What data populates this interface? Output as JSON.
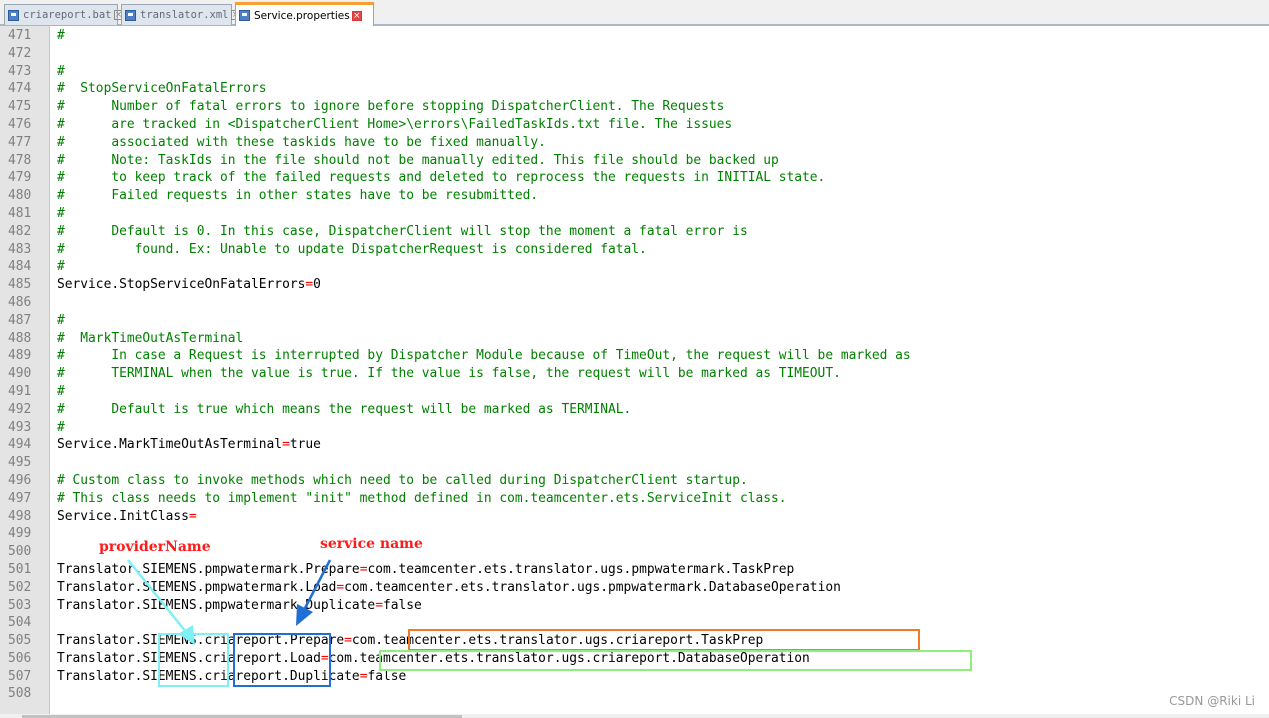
{
  "tabs": [
    {
      "label": "criareport.bat",
      "active": false
    },
    {
      "label": "translator.xml",
      "active": false
    },
    {
      "label": "Service.properties",
      "active": true
    }
  ],
  "editor": {
    "lines": [
      {
        "num": "471",
        "text": "#"
      },
      {
        "num": "472",
        "text": ""
      },
      {
        "num": "473",
        "text": "#"
      },
      {
        "num": "474",
        "text": "#  StopServiceOnFatalErrors"
      },
      {
        "num": "475",
        "text": "#      Number of fatal errors to ignore before stopping DispatcherClient. The Requests"
      },
      {
        "num": "476",
        "text": "#      are tracked in <DispatcherClient Home>\\errors\\FailedTaskIds.txt file. The issues"
      },
      {
        "num": "477",
        "text": "#      associated with these taskids have to be fixed manually."
      },
      {
        "num": "478",
        "text": "#      Note: TaskIds in the file should not be manually edited. This file should be backed up"
      },
      {
        "num": "479",
        "text": "#      to keep track of the failed requests and deleted to reprocess the requests in INITIAL state."
      },
      {
        "num": "480",
        "text": "#      Failed requests in other states have to be resubmitted."
      },
      {
        "num": "481",
        "text": "#"
      },
      {
        "num": "482",
        "text": "#      Default is 0. In this case, DispatcherClient will stop the moment a fatal error is"
      },
      {
        "num": "483",
        "text": "#         found. Ex: Unable to update DispatcherRequest is considered fatal."
      },
      {
        "num": "484",
        "text": "#"
      },
      {
        "num": "485",
        "key": "Service.StopServiceOnFatalErrors",
        "value": "0"
      },
      {
        "num": "486",
        "text": ""
      },
      {
        "num": "487",
        "text": "#"
      },
      {
        "num": "488",
        "text": "#  MarkTimeOutAsTerminal"
      },
      {
        "num": "489",
        "text": "#      In case a Request is interrupted by Dispatcher Module because of TimeOut, the request will be marked as"
      },
      {
        "num": "490",
        "text": "#      TERMINAL when the value is true. If the value is false, the request will be marked as TIMEOUT."
      },
      {
        "num": "491",
        "text": "#"
      },
      {
        "num": "492",
        "text": "#      Default is true which means the request will be marked as TERMINAL."
      },
      {
        "num": "493",
        "text": "#"
      },
      {
        "num": "494",
        "key": "Service.MarkTimeOutAsTerminal",
        "value": "true"
      },
      {
        "num": "495",
        "text": ""
      },
      {
        "num": "496",
        "text": "# Custom class to invoke methods which need to be called during DispatcherClient startup."
      },
      {
        "num": "497",
        "text": "# This class needs to implement \"init\" method defined in com.teamcenter.ets.ServiceInit class."
      },
      {
        "num": "498",
        "key": "Service.InitClass",
        "value": ""
      },
      {
        "num": "499",
        "text": ""
      },
      {
        "num": "500",
        "text": ""
      },
      {
        "num": "501",
        "key": "Translator.SIEMENS.pmpwatermark.Prepare",
        "value": "com.teamcenter.ets.translator.ugs.pmpwatermark.TaskPrep"
      },
      {
        "num": "502",
        "key": "Translator.SIEMENS.pmpwatermark.Load",
        "value": "com.teamcenter.ets.translator.ugs.pmpwatermark.DatabaseOperation"
      },
      {
        "num": "503",
        "key": "Translator.SIEMENS.pmpwatermark.Duplicate",
        "value": "false"
      },
      {
        "num": "504",
        "text": ""
      },
      {
        "num": "505",
        "key": "Translator.SIEMENS.criareport.Prepare",
        "value": "com.teamcenter.ets.translator.ugs.criareport.TaskPrep"
      },
      {
        "num": "506",
        "key": "Translator.SIEMENS.criareport.Load",
        "value": "com.teamcenter.ets.translator.ugs.criareport.DatabaseOperation"
      },
      {
        "num": "507",
        "key": "Translator.SIEMENS.criareport.Duplicate",
        "value": "false"
      },
      {
        "num": "508",
        "text": ""
      }
    ]
  },
  "annotations": {
    "provider_label": "providerName",
    "service_label": "service name",
    "provider_color": "#7ff0f5",
    "service_color": "#1f6fd6",
    "prepare_box_color": "#f07a2a",
    "load_box_color": "#8ef07a",
    "provider_label_color": "#ff1a1a",
    "service_label_color": "#ff1a1a"
  },
  "watermark": "CSDN @Riki Li",
  "colors": {
    "comment": "#008000",
    "operator": "#ff0000",
    "line_number": "#808080",
    "gutter_bg": "#e4e4e4",
    "active_tab_accent": "#f5a030"
  }
}
